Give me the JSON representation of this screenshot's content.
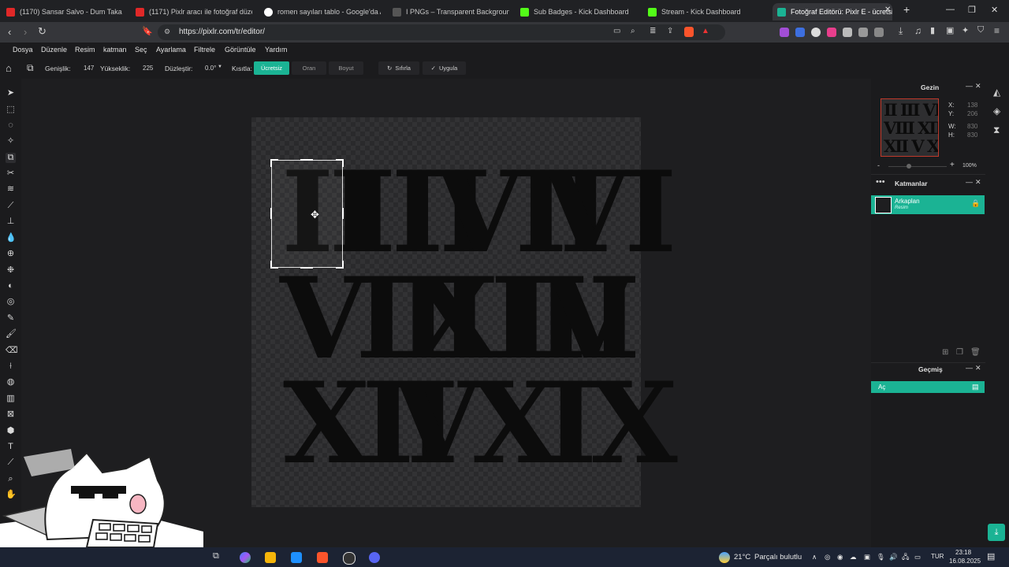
{
  "browser": {
    "tabs": [
      {
        "title": "(1170) Sansar Salvo - Dum Taka",
        "active": false
      },
      {
        "title": "(1171) Pixlr aracı ile fotoğraf düzenle",
        "active": false
      },
      {
        "title": "romen sayıları tablo - Google'da Ara",
        "active": false
      },
      {
        "title": "I PNGs – Transparent Background Im",
        "active": false
      },
      {
        "title": "Sub Badges - Kick Dashboard",
        "active": false
      },
      {
        "title": "Stream - Kick Dashboard",
        "active": false
      },
      {
        "title": "Fotoğraf Editörü: Pixlr E - ücretsi",
        "active": true
      }
    ],
    "new_tab_label": "+",
    "url": "https://pixlr.com/tr/editor/"
  },
  "menu": [
    "Dosya",
    "Düzenle",
    "Resim",
    "katman",
    "Seç",
    "Ayarlama",
    "Filtrele",
    "Görüntüle",
    "Yardım"
  ],
  "options": {
    "width_label": "Genişlik:",
    "width_value": "147",
    "height_label": "Yükseklik:",
    "height_value": "225",
    "straighten_label": "Düzleştir:",
    "straighten_value": "0.0°",
    "constrain_label": "Kısıtla:",
    "constrain_free": "Ücretsiz",
    "constrain_ratio": "Oran",
    "constrain_size": "Boyut",
    "reset_label": "Sıfırla",
    "apply_label": "Uygula"
  },
  "canvas": {
    "numerals": [
      "II",
      "III",
      "VII",
      "VI",
      "VIII",
      "XII",
      "IV",
      "I",
      "XII",
      "V",
      "X",
      "IX"
    ]
  },
  "navigator": {
    "title": "Gezin",
    "x_label": "X:",
    "x_value": "138",
    "y_label": "Y:",
    "y_value": "206",
    "w_label": "W:",
    "w_value": "830",
    "h_label": "H:",
    "h_value": "830",
    "zoom_minus": "-",
    "zoom_plus": "+",
    "zoom_value": "100%"
  },
  "layers": {
    "title": "Katmanlar",
    "items": [
      {
        "name": "Arkaplan",
        "type": "Resim"
      }
    ]
  },
  "history": {
    "title": "Geçmiş",
    "items": [
      "Aç"
    ]
  },
  "taskbar": {
    "weather": "21°C",
    "weather_desc": "Parçalı bulutlu",
    "lang": "TUR",
    "time": "23:18",
    "date": "16.08.2025"
  },
  "colors": {
    "accent": "#1bb394",
    "crop_handles": "#ffffff"
  }
}
